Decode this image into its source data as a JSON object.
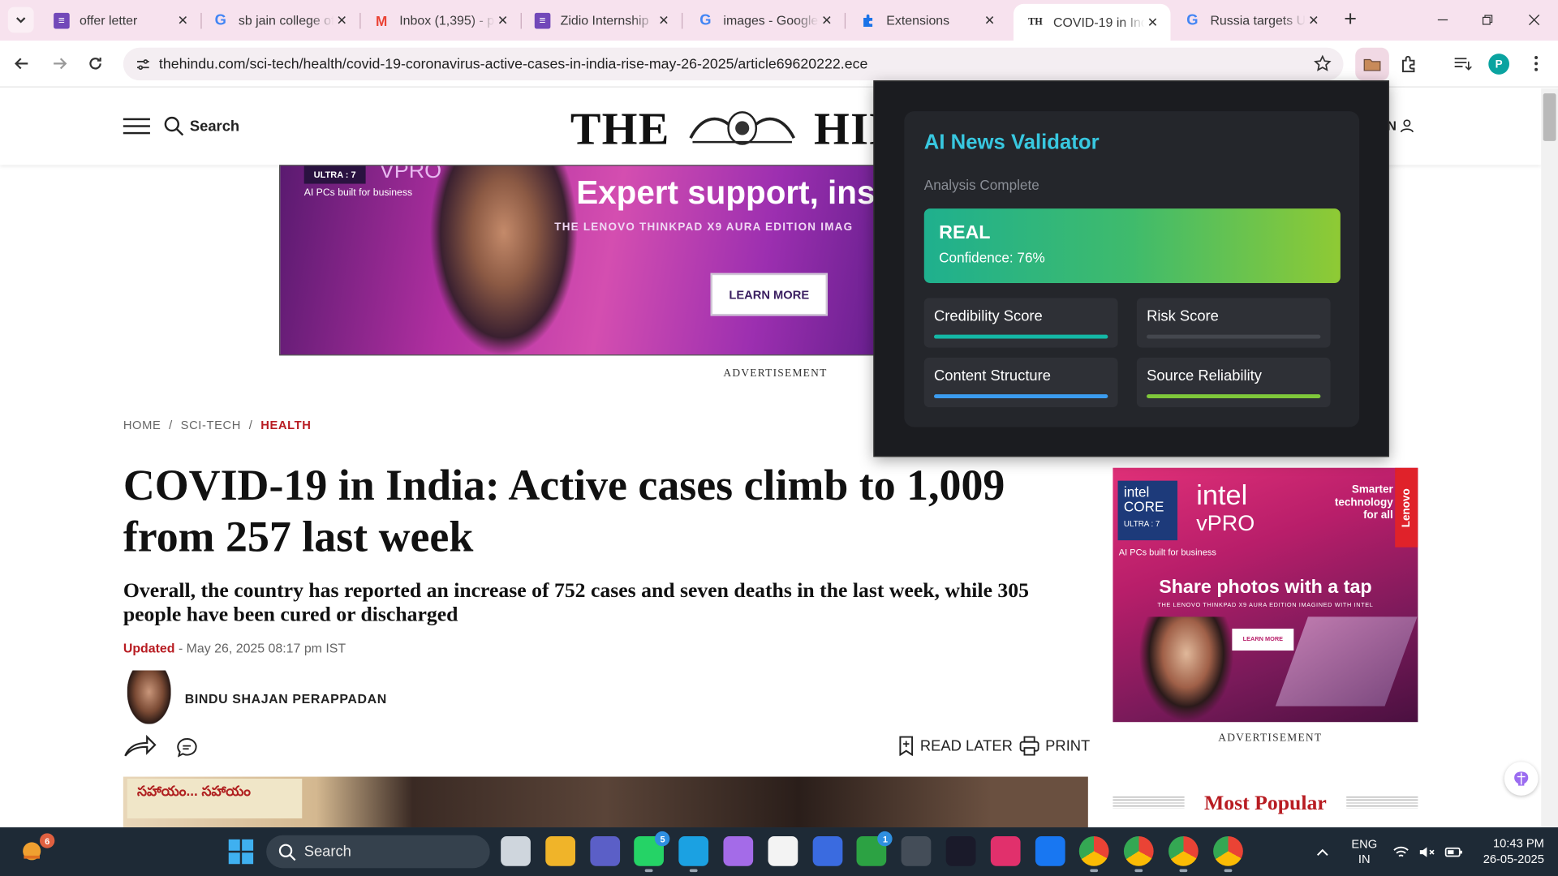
{
  "browser": {
    "tabs": [
      {
        "title": "offer letter",
        "favicon": "forms-icon"
      },
      {
        "title": "sb jain college of",
        "favicon": "google-icon"
      },
      {
        "title": "Inbox (1,395) - p",
        "favicon": "gmail-icon"
      },
      {
        "title": "Zidio Internship",
        "favicon": "forms-icon"
      },
      {
        "title": "images - Google",
        "favicon": "google-icon"
      },
      {
        "title": "Extensions",
        "favicon": "puzzle-icon"
      },
      {
        "title": "COVID-19 in Ind",
        "favicon": "th-icon",
        "favicon_text": "TH",
        "active": true
      },
      {
        "title": "Russia targets U",
        "favicon": "google-icon"
      }
    ],
    "url": "thehindu.com/sci-tech/health/covid-19-coronavirus-active-cases-in-india-rise-may-26-2025/article69620222.ece",
    "profile_initial": "P"
  },
  "site": {
    "search_label": "Search",
    "logo_left": "THE",
    "logo_right": "HIN",
    "signin_label": "N"
  },
  "ad_top": {
    "badge": "ULTRA : 7",
    "brand": "VPRO",
    "subtitle": "AI PCs built for business",
    "headline": "Expert support, ins",
    "tagline": "THE LENOVO THINKPAD X9 AURA EDITION IMAG",
    "cta": "LEARN MORE",
    "label": "ADVERTISEMENT"
  },
  "article": {
    "breadcrumb": [
      "HOME",
      "SCI-TECH",
      "HEALTH"
    ],
    "headline": "COVID-19 in India: Active cases climb to 1,009 from 257 last week",
    "deck": "Overall, the country has reported an increase of 752 cases and seven deaths in the last week, while 305 people have been cured or discharged",
    "updated_label": "Updated",
    "updated_value": "- May 26, 2025 08:17 pm IST",
    "author": "BINDU SHAJAN PERAPPADAN",
    "read_later": "READ LATER",
    "print": "PRINT",
    "photo_sign": "సహాయం... సహాయం"
  },
  "ad_right": {
    "intel_core": "intel CORE",
    "ultra": "ULTRA : 7",
    "intel": "intel",
    "vpro": "vPRO",
    "smarter": "Smarter technology for all",
    "lenovo": "Lenovo",
    "subtitle": "AI PCs built for business",
    "headline": "Share photos with a tap",
    "tagline": "THE LENOVO THINKPAD X9 AURA EDITION IMAGINED WITH INTEL",
    "cta": "LEARN MORE",
    "label": "ADVERTISEMENT"
  },
  "most_popular": "Most Popular",
  "extension": {
    "title": "AI News Validator",
    "status": "Analysis Complete",
    "verdict": "REAL",
    "confidence": "Confidence: 76%",
    "metrics": [
      {
        "label": "Credibility Score",
        "value": 1.0,
        "color": "#14b8a6"
      },
      {
        "label": "Risk Score",
        "value": 0.0,
        "color": "#ef4444"
      },
      {
        "label": "Content Structure",
        "value": 1.0,
        "color": "#3b9cf0"
      },
      {
        "label": "Source Reliability",
        "value": 1.0,
        "color": "#7fc83a"
      }
    ]
  },
  "taskbar": {
    "weather_badge": "6",
    "search_placeholder": "Search",
    "apps": [
      {
        "name": "task-view",
        "color": "#cfd6dd"
      },
      {
        "name": "file-explorer",
        "color": "#f0b429"
      },
      {
        "name": "teams",
        "color": "#5b5fc7"
      },
      {
        "name": "whatsapp",
        "color": "#25d366",
        "badge": "5"
      },
      {
        "name": "edge",
        "color": "#1ba1e2"
      },
      {
        "name": "copilot",
        "color": "#a46be8"
      },
      {
        "name": "microsoft-store",
        "color": "#f3f3f3"
      },
      {
        "name": "visual-studio-app",
        "color": "#3a6be0"
      },
      {
        "name": "xbox",
        "color": "#2ca243",
        "badge": "1"
      },
      {
        "name": "epic-app",
        "color": "#444d58"
      },
      {
        "name": "affinity-app",
        "color": "#1a1a2a"
      },
      {
        "name": "instagram",
        "color": "#e1306c"
      },
      {
        "name": "facebook",
        "color": "#1877f2"
      },
      {
        "name": "chrome-1",
        "color": "#e04c3c"
      },
      {
        "name": "chrome-2",
        "color": "#34a853"
      },
      {
        "name": "chrome-3",
        "color": "#ea4335"
      },
      {
        "name": "chrome-4",
        "color": "#4285f4"
      }
    ],
    "lang_1": "ENG",
    "lang_2": "IN",
    "time": "10:43 PM",
    "date": "26-05-2025"
  }
}
